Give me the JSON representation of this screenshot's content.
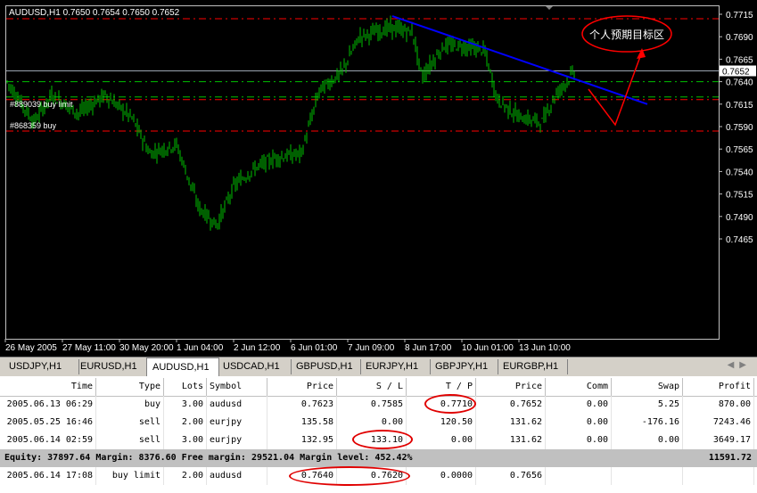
{
  "chart": {
    "header": "AUDUSD,H1 0.7650 0.7654 0.7650 0.7652",
    "annotation": "个人预期目标区",
    "order_labels": [
      "#889039 buy limit",
      "#868359 buy"
    ],
    "current_price": "0.7652",
    "price_axis": [
      "0.7715",
      "0.7690",
      "0.7665",
      "0.7640",
      "0.7615",
      "0.7590",
      "0.7565",
      "0.7540",
      "0.7515",
      "0.7490",
      "0.7465"
    ],
    "time_axis": [
      "26 May 2005",
      "27 May 11:00",
      "30 May 20:00",
      "1 Jun 04:00",
      "2 Jun 12:00",
      "6 Jun 01:00",
      "7 Jun 09:00",
      "8 Jun 17:00",
      "10 Jun 01:00",
      "13 Jun 10:00"
    ],
    "colors": {
      "background": "#000000",
      "candles": "#00c000",
      "trendline": "#0000ff",
      "levels": "#ff0000",
      "annotation": "#ff0000"
    }
  },
  "tabs": [
    "USDJPY,H1",
    "EURUSD,H1",
    "AUDUSD,H1",
    "USDCAD,H1",
    "GBPUSD,H1",
    "EURJPY,H1",
    "GBPJPY,H1",
    "EURGBP,H1"
  ],
  "active_tab": "AUDUSD,H1",
  "terminal": {
    "columns": [
      "Time",
      "Type",
      "Lots",
      "Symbol",
      "Price",
      "S / L",
      "T / P",
      "Price",
      "Comm",
      "Swap",
      "Profit"
    ],
    "rows": [
      [
        "2005.06.13 06:29",
        "buy",
        "3.00",
        "audusd",
        "0.7623",
        "0.7585",
        "0.7710",
        "0.7652",
        "0.00",
        "5.25",
        "870.00"
      ],
      [
        "2005.05.25 16:46",
        "sell",
        "2.00",
        "eurjpy",
        "135.58",
        "0.00",
        "120.50",
        "131.62",
        "0.00",
        "-176.16",
        "7243.46"
      ],
      [
        "2005.06.14 02:59",
        "sell",
        "3.00",
        "eurjpy",
        "132.95",
        "133.10",
        "0.00",
        "131.62",
        "0.00",
        "0.00",
        "3649.17"
      ]
    ],
    "equity": {
      "text": "Equity: 37897.64  Margin: 8376.60  Free margin: 29521.04  Margin level: 452.42%",
      "total": "11591.72"
    },
    "pending": [
      "2005.06.14 17:08",
      "buy limit",
      "2.00",
      "audusd",
      "0.7640",
      "0.7620",
      "0.0000",
      "0.7656",
      "",
      "",
      ""
    ]
  }
}
